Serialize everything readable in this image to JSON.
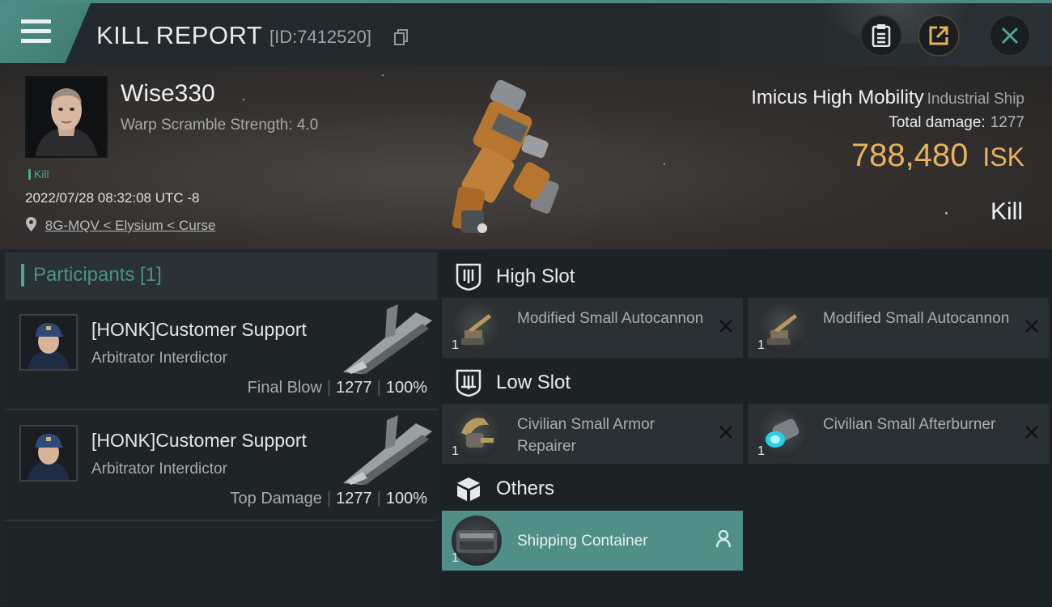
{
  "header": {
    "title": "KILL REPORT",
    "report_id": "[ID:7412520]"
  },
  "victim": {
    "name": "Wise330",
    "warp_scramble": "Warp Scramble Strength: 4.0",
    "tag": "Kill",
    "datetime": "2022/07/28 08:32:08 UTC -8",
    "location": "8G-MQV < Elysium < Curse"
  },
  "ship": {
    "name": "Imicus High Mobility",
    "class": "Industrial Ship",
    "total_damage_label": "Total damage:",
    "total_damage": "1277",
    "value": "788,480",
    "currency": "ISK",
    "result": "Kill"
  },
  "participants": {
    "header": "Participants [1]",
    "rows": [
      {
        "name": "[HONK]Customer Support",
        "ship": "Arbitrator Interdictor",
        "role": "Final Blow",
        "damage": "1277",
        "percent": "100%"
      },
      {
        "name": "[HONK]Customer Support",
        "ship": "Arbitrator Interdictor",
        "role": "Top Damage",
        "damage": "1277",
        "percent": "100%"
      }
    ]
  },
  "fitting": {
    "high_slot": {
      "label": "High Slot",
      "modules": [
        {
          "name": "Modified Small Autocannon",
          "qty": "1"
        },
        {
          "name": "Modified Small Autocannon",
          "qty": "1"
        }
      ]
    },
    "low_slot": {
      "label": "Low Slot",
      "modules": [
        {
          "name": "Civilian Small Armor Repairer",
          "qty": "1"
        },
        {
          "name": "Civilian Small Afterburner",
          "qty": "1"
        }
      ]
    },
    "others": {
      "label": "Others",
      "modules": [
        {
          "name": "Shipping Container",
          "qty": "1"
        }
      ]
    }
  },
  "colors": {
    "accent": "#4f8f87",
    "isk": "#e7b25b",
    "panel": "#202528"
  },
  "icons": [
    "menu-icon",
    "copy-icon",
    "clipboard-icon",
    "share-icon",
    "close-icon",
    "location-pin-icon",
    "high-slot-icon",
    "low-slot-icon",
    "others-box-icon",
    "remove-x-icon",
    "person-icon"
  ]
}
